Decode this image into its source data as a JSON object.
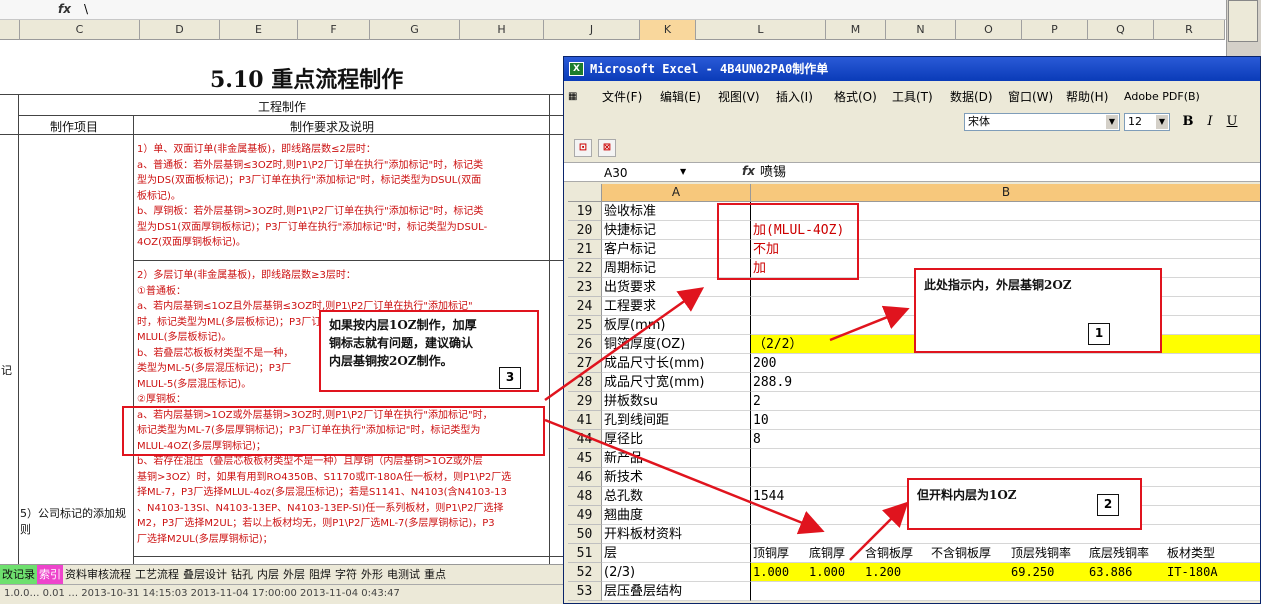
{
  "background_sheet": {
    "formula_bar": {
      "fx": "fx",
      "value": "\\"
    },
    "columns": [
      "C",
      "D",
      "E",
      "F",
      "G",
      "H",
      "J",
      "K",
      "L",
      "M",
      "N",
      "O",
      "P",
      "Q",
      "R"
    ],
    "selected_column": "K",
    "doc_title": "5.10 重点流程制作",
    "table_header": "工程制作",
    "col_headers": {
      "item": "制作项目",
      "req": "制作要求及说明"
    },
    "side_label_1": "记",
    "side_label_2": "5）公司标记的添加规则",
    "block1": [
      "1）单、双面订单(非金属基板)，即线路层数≤2层时：",
      "a、普通板：若外层基铜≤3OZ时,则P1\\P2厂订单在执行\"添加标记\"时，标记类",
      "型为DS(双面板标记)；P3厂订单在执行\"添加标记\"时，标记类型为DSUL(双面",
      "板标记)。",
      "b、厚铜板：若外层基铜>3OZ时,则P1\\P2厂订单在执行\"添加标记\"时，标记类",
      "型为DS1(双面厚铜板标记)；P3厂订单在执行\"添加标记\"时，标记类型为DSUL-",
      "4OZ(双面厚铜板标记)。"
    ],
    "block2": [
      "2）多层订单(非金属基板)，即线路层数≥3层时：",
      "①普通板：",
      "a、若内层基铜≤1OZ且外层基铜≤3OZ时,则P1\\P2厂订单在执行\"添加标记\"",
      "时，标记类型为ML(多层板标记)；P3厂订单在执行\"添加标记\"时，",
      "MLUL(多层板标记)。",
      "b、若叠层芯板板材类型不是一种，",
      "类型为ML-5(多层混压标记)；P3厂",
      "MLUL-5(多层混压标记)。",
      "②厚铜板：",
      "a、若内层基铜>1OZ或外层基铜>3OZ时,则P1\\P2厂订单在执行\"添加标记\"时，",
      "标记类型为ML-7(多层厚铜标记)；P3厂订单在执行\"添加标记\"时，标记类型为",
      "MLUL-4OZ(多层厚铜标记)；",
      "b、若存在混压（叠层芯板板材类型不是一种）且厚铜（内层基铜>1OZ或外层",
      "基铜>3OZ）时，如果有用到RO4350B、S1170或IT-180A任一板材，则P1\\P2厂选",
      "择ML-7，P3厂选择MLUL-4oz(多层混压标记)；若是S1141、N4103(含N4103-13",
      "、N4103-13SI、N4103-13EP、N4103-13EP-SI)任一系列板材，则P1\\P2厂选择",
      "M2，P3厂选择M2UL；若以上板材均无，则P1\\P2厂选ML-7(多层厚铜标记)，P3",
      "厂选择M2UL(多层厚铜标记)；"
    ],
    "tabs": [
      {
        "label": "改记录",
        "style": "green"
      },
      {
        "label": "索引",
        "style": "magenta"
      },
      {
        "label": "资料审核流程",
        "style": ""
      },
      {
        "label": "工艺流程",
        "style": ""
      },
      {
        "label": "叠层设计",
        "style": ""
      },
      {
        "label": "钻孔",
        "style": ""
      },
      {
        "label": "内层",
        "style": ""
      },
      {
        "label": "外层",
        "style": ""
      },
      {
        "label": "阻焊",
        "style": ""
      },
      {
        "label": "字符",
        "style": ""
      },
      {
        "label": "外形",
        "style": ""
      },
      {
        "label": "电测试",
        "style": ""
      },
      {
        "label": "重点",
        "style": ""
      }
    ],
    "status_text": "1.0.0… 0.01 … 2013-10-31 14:15:03 2013-11-04 17:00:00 2013-11-04 0:43:47"
  },
  "excel_window": {
    "title": "Microsoft Excel - 4B4UN02PA0制作单",
    "icon": "excel-icon",
    "menu": [
      "文件(F)",
      "编辑(E)",
      "视图(V)",
      "插入(I)",
      "格式(O)",
      "工具(T)",
      "数据(D)",
      "窗口(W)",
      "帮助(H)",
      "Adobe PDF(B)"
    ],
    "font_name": "宋体",
    "font_size": "12",
    "format_buttons": [
      "B",
      "I",
      "U"
    ],
    "name_box": "A30",
    "fx": "fx",
    "formula_value": "喷锡",
    "col_a": "A",
    "col_b": "B",
    "rows": [
      {
        "num": "19",
        "a": "验收标准",
        "b": "",
        "style": ""
      },
      {
        "num": "20",
        "a": "快捷标记",
        "b": "加(MLUL-4OZ)",
        "style": "red"
      },
      {
        "num": "21",
        "a": "客户标记",
        "b": "不加",
        "style": "red"
      },
      {
        "num": "22",
        "a": "周期标记",
        "b": "加",
        "style": "red"
      },
      {
        "num": "23",
        "a": "出货要求",
        "b": "",
        "style": ""
      },
      {
        "num": "24",
        "a": "工程要求",
        "b": "",
        "style": ""
      },
      {
        "num": "25",
        "a": "板厚(mm)",
        "b": "",
        "style": ""
      },
      {
        "num": "26",
        "a": "铜箔厚度(OZ)",
        "b": "（2/2）",
        "style": "hl"
      },
      {
        "num": "27",
        "a": "成品尺寸长(mm)",
        "b": "200",
        "style": ""
      },
      {
        "num": "28",
        "a": "成品尺寸宽(mm)",
        "b": "288.9",
        "style": ""
      },
      {
        "num": "29",
        "a": "拼板数su",
        "b": "2",
        "style": ""
      },
      {
        "num": "41",
        "a": "孔到线间距",
        "b": "10",
        "style": ""
      },
      {
        "num": "44",
        "a": "厚径比",
        "b": "8",
        "style": ""
      },
      {
        "num": "45",
        "a": "新产品",
        "b": "",
        "style": ""
      },
      {
        "num": "46",
        "a": "新技术",
        "b": "",
        "style": ""
      },
      {
        "num": "48",
        "a": "总孔数",
        "b": "1544",
        "style": ""
      },
      {
        "num": "49",
        "a": "翘曲度",
        "b": "",
        "style": ""
      },
      {
        "num": "50",
        "a": "开料板材资料",
        "b": "",
        "style": ""
      }
    ],
    "row51": {
      "num": "51",
      "a": "层",
      "cells": [
        "顶铜厚",
        "底铜厚",
        "含铜板厚",
        "不含铜板厚",
        "顶层残铜率",
        "底层残铜率",
        "板材类型"
      ]
    },
    "row52": {
      "num": "52",
      "a": "(2/3)",
      "cells": [
        "1.000",
        "1.000",
        "1.200",
        "",
        "69.250",
        "63.886",
        "IT-180A"
      ]
    },
    "row53": {
      "num": "53",
      "a": "层压叠层结构",
      "b": ""
    }
  },
  "annotations": {
    "note1": {
      "text": "此处指示内，外层基铜2OZ",
      "num": "1"
    },
    "note2": {
      "text": "但开料内层为1OZ",
      "num": "2"
    },
    "note3": {
      "lines": [
        "如果按内层1OZ制作，加厚",
        "铜标志就有问题，建议确认",
        "内层基铜按2OZ制作。"
      ],
      "num": "3"
    }
  }
}
